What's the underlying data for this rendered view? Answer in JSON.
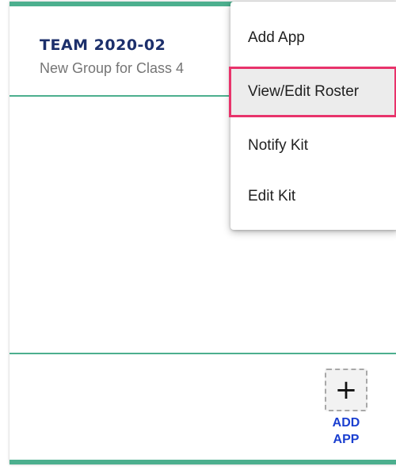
{
  "team_card": {
    "title": "TEAM 2020-02",
    "subtitle": "New Group for Class 4",
    "accent_color": "#4caf8e",
    "add_app_button": {
      "icon": "plus-icon",
      "icon_glyph": "+",
      "label_line1": "ADD",
      "label_line2": "APP"
    }
  },
  "context_menu": {
    "highlight_color": "#e8336b",
    "highlighted_item": "View/Edit Roster",
    "items": [
      {
        "label": "Add App"
      },
      {
        "label": "View/Edit Roster"
      },
      {
        "label": "Notify Kit"
      },
      {
        "label": "Edit Kit"
      }
    ]
  }
}
